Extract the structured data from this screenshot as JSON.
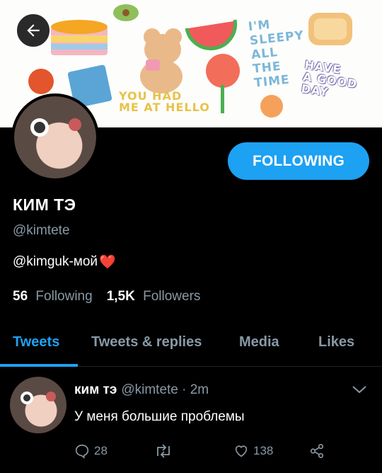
{
  "banner": {
    "text_you_had": "YOU HAD\nME AT HELLO",
    "text_sleepy": "I'M\nSLEEPY\nALL\nTHE\nTIME",
    "text_have_good_day": "HAVE\nA GOOD\nDAY"
  },
  "profile": {
    "name": "КИМ ТЭ",
    "handle": "@kimtete",
    "bio_text": "@kimguk-мой",
    "bio_emoji": "❤️",
    "follow_button_label": "FOLLOWING",
    "following_count": "56",
    "following_label": "Following",
    "followers_count": "1,5K",
    "followers_label": "Followers"
  },
  "tabs": [
    {
      "label": "Tweets",
      "active": true
    },
    {
      "label": "Tweets & replies",
      "active": false
    },
    {
      "label": "Media",
      "active": false
    },
    {
      "label": "Likes",
      "active": false
    }
  ],
  "tweet": {
    "author_name": "ким тэ",
    "author_handle_time": "@kimtete · 2m",
    "text": "У меня большие проблемы",
    "reply_count": "28",
    "retweet_count": "",
    "like_count": "138"
  },
  "colors": {
    "accent": "#1da1f2",
    "muted": "#8899a6",
    "background": "#000000"
  }
}
